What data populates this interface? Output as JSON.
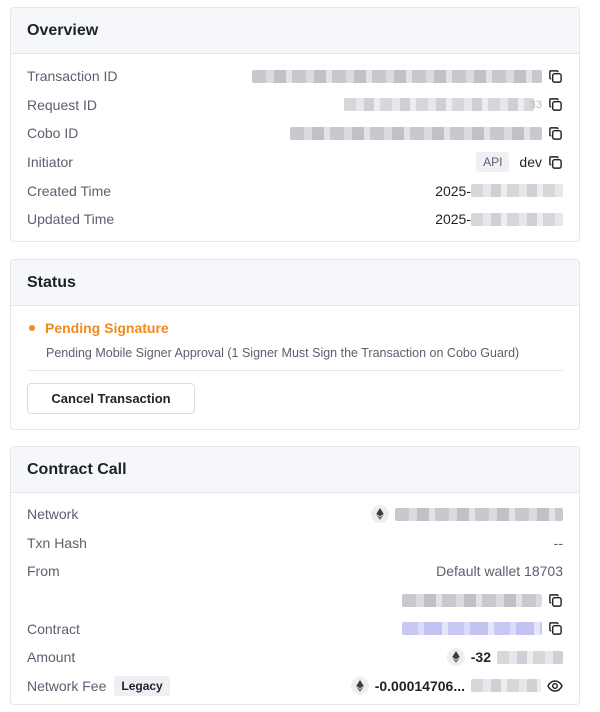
{
  "overview": {
    "title": "Overview",
    "fields": {
      "transaction_id": {
        "label": "Transaction ID"
      },
      "request_id": {
        "label": "Request ID",
        "visible_suffix": "33"
      },
      "cobo_id": {
        "label": "Cobo ID"
      },
      "initiator": {
        "label": "Initiator",
        "badge": "API",
        "value": "dev"
      },
      "created_time": {
        "label": "Created Time",
        "value": "2025-"
      },
      "updated_time": {
        "label": "Updated Time",
        "value": "2025-"
      }
    }
  },
  "status": {
    "title": "Status",
    "state": "Pending Signature",
    "state_color": "#f2891f",
    "description": "Pending Mobile Signer Approval (1 Signer Must Sign the Transaction on Cobo Guard)",
    "cancel_label": "Cancel Transaction"
  },
  "contract_call": {
    "title": "Contract Call",
    "fields": {
      "network": {
        "label": "Network",
        "icon": "eth-icon"
      },
      "txn_hash": {
        "label": "Txn Hash",
        "value": "--"
      },
      "from": {
        "label": "From",
        "value": "Default wallet 18703"
      },
      "contract": {
        "label": "Contract"
      },
      "amount": {
        "label": "Amount",
        "value": "-32",
        "icon": "eth-icon"
      },
      "network_fee": {
        "label": "Network Fee",
        "badge": "Legacy",
        "value": "-0.00014706...",
        "icon": "eth-icon"
      }
    }
  },
  "colors": {
    "header_bg": "#f5f7fa",
    "border": "#e3e6ec",
    "accent_warning": "#f2891f"
  }
}
